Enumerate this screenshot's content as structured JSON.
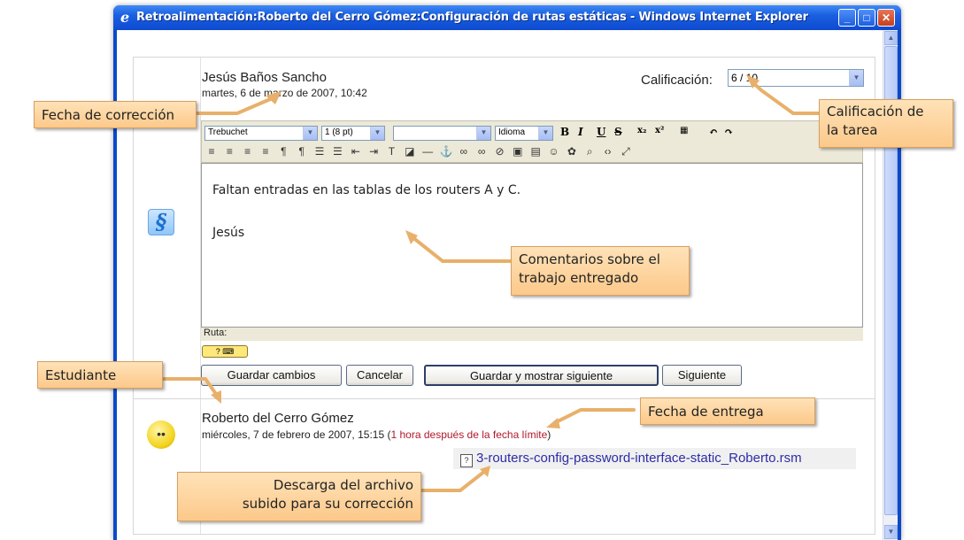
{
  "window": {
    "title": "Retroalimentación:Roberto del Cerro Gómez:Configuración de rutas estáticas - Windows Internet Explorer",
    "controls": {
      "minimize": "_",
      "maximize": "□",
      "close": "✕"
    }
  },
  "teacher": {
    "name": "Jesús Baños Sancho",
    "date": "martes, 6 de marzo de 2007, 10:42"
  },
  "grade": {
    "label": "Calificación:",
    "value": "6 / 10"
  },
  "editor": {
    "font_family": "Trebuchet",
    "font_size": "1 (8 pt)",
    "heading": "",
    "language": "Idioma",
    "content_lines": [
      "Faltan entradas en las tablas de los routers A y C.",
      "Jesús"
    ],
    "path_label": "Ruta:"
  },
  "buttons": {
    "save": "Guardar cambios",
    "cancel": "Cancelar",
    "save_next": "Guardar y mostrar siguiente",
    "next": "Siguiente"
  },
  "student": {
    "name": "Roberto del Cerro Gómez",
    "date": "miércoles, 7 de febrero de 2007, 15:15",
    "late_text": "1 hora después de la fecha límite",
    "file_name": "3-routers-config-password-interface-static_Roberto.rsm"
  },
  "callouts": {
    "correction_date": "Fecha de corrección",
    "task_grade_line1": "Calificación de",
    "task_grade_line2": "la tarea",
    "comments_line1": "Comentarios sobre el",
    "comments_line2": "trabajo entregado",
    "student": "Estudiante",
    "submission_date": "Fecha de entrega",
    "download_line1": "Descarga del archivo",
    "download_line2": "subido para su corrección"
  },
  "colors": {
    "callout_bg": "#fcd09a",
    "late_text": "#b0192b",
    "link": "#2c2ca8",
    "titlebar": "#0d4ad1"
  }
}
